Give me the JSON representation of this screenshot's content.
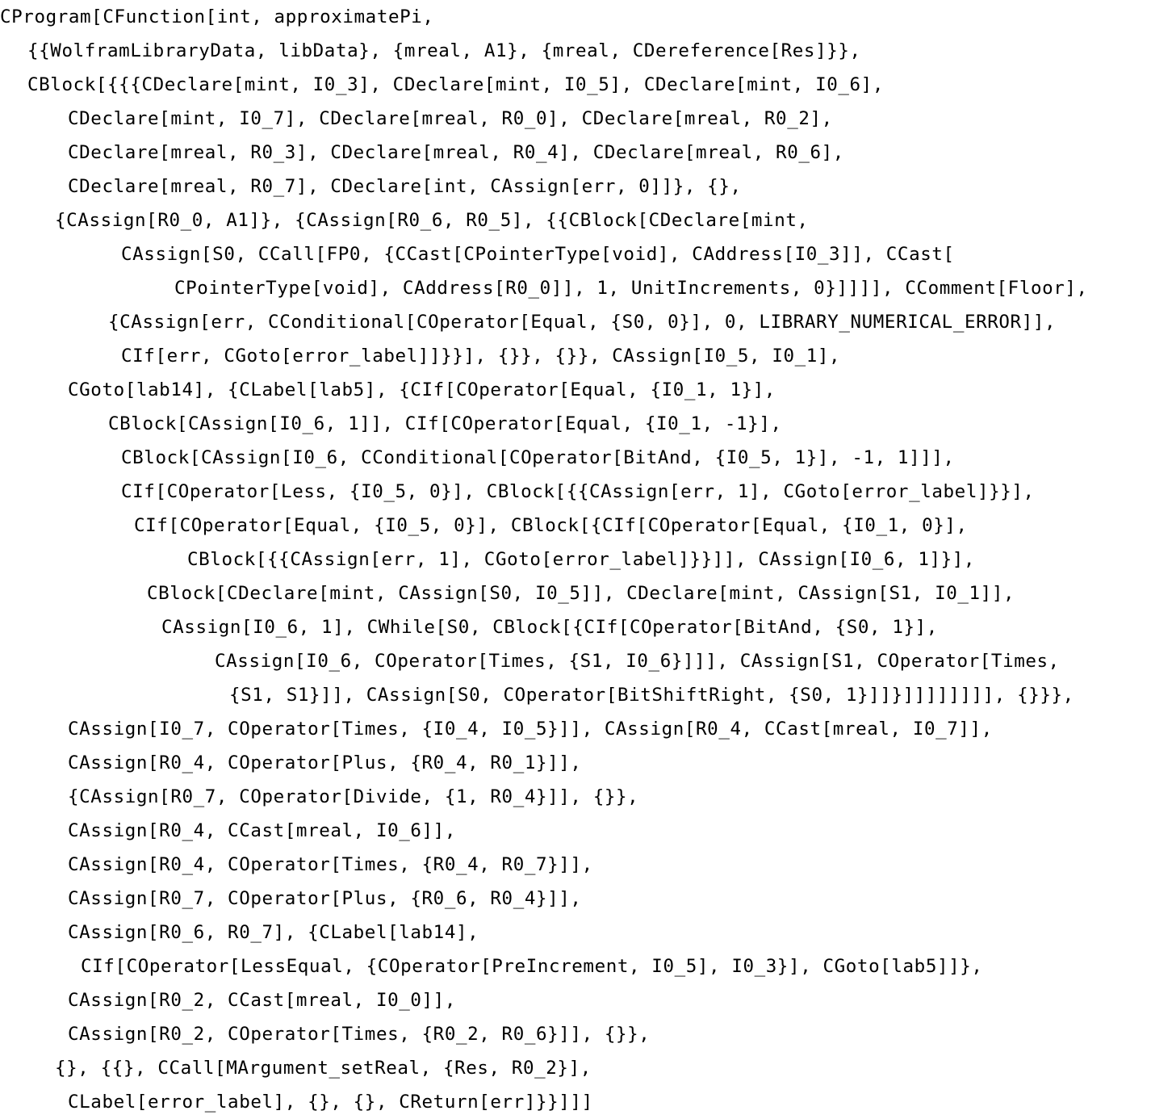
{
  "code": {
    "lines": [
      "CProgram[CFunction[int, approximatePi,",
      "  {{WolframLibraryData, libData}, {mreal, A1}, {mreal, CDereference[Res]}},",
      "  CBlock[{{{CDeclare[mint, I0_3], CDeclare[mint, I0_5], CDeclare[mint, I0_6],",
      "     CDeclare[mint, I0_7], CDeclare[mreal, R0_0], CDeclare[mreal, R0_2],",
      "     CDeclare[mreal, R0_3], CDeclare[mreal, R0_4], CDeclare[mreal, R0_6],",
      "     CDeclare[mreal, R0_7], CDeclare[int, CAssign[err, 0]]}, {},",
      "    {CAssign[R0_0, A1]}, {CAssign[R0_6, R0_5], {{CBlock[CDeclare[mint,",
      "         CAssign[S0, CCall[FP0, {CCast[CPointerType[void], CAddress[I0_3]], CCast[",
      "             CPointerType[void], CAddress[R0_0]], 1, UnitIncrements, 0}]]]], CComment[Floor],",
      "        {CAssign[err, CConditional[COperator[Equal, {S0, 0}], 0, LIBRARY_NUMERICAL_ERROR]],",
      "         CIf[err, CGoto[error_label]]}}], {}}, {}}, CAssign[I0_5, I0_1],",
      "     CGoto[lab14], {CLabel[lab5], {CIf[COperator[Equal, {I0_1, 1}],",
      "        CBlock[CAssign[I0_6, 1]], CIf[COperator[Equal, {I0_1, -1}],",
      "         CBlock[CAssign[I0_6, CConditional[COperator[BitAnd, {I0_5, 1}], -1, 1]]],",
      "         CIf[COperator[Less, {I0_5, 0}], CBlock[{{CAssign[err, 1], CGoto[error_label]}}],",
      "          CIf[COperator[Equal, {I0_5, 0}], CBlock[{CIf[COperator[Equal, {I0_1, 0}],",
      "              CBlock[{{CAssign[err, 1], CGoto[error_label]}}]], CAssign[I0_6, 1]}],",
      "           CBlock[CDeclare[mint, CAssign[S0, I0_5]], CDeclare[mint, CAssign[S1, I0_1]],",
      "            CAssign[I0_6, 1], CWhile[S0, CBlock[{CIf[COperator[BitAnd, {S0, 1}],",
      "                CAssign[I0_6, COperator[Times, {S1, I0_6}]]], CAssign[S1, COperator[Times,",
      "                 {S1, S1}]], CAssign[S0, COperator[BitShiftRight, {S0, 1}]]}]]]]]]]], {}}},",
      "     CAssign[I0_7, COperator[Times, {I0_4, I0_5}]], CAssign[R0_4, CCast[mreal, I0_7]],",
      "     CAssign[R0_4, COperator[Plus, {R0_4, R0_1}]],",
      "     {CAssign[R0_7, COperator[Divide, {1, R0_4}]], {}},",
      "     CAssign[R0_4, CCast[mreal, I0_6]],",
      "     CAssign[R0_4, COperator[Times, {R0_4, R0_7}]],",
      "     CAssign[R0_7, COperator[Plus, {R0_6, R0_4}]],",
      "     CAssign[R0_6, R0_7], {CLabel[lab14],",
      "      CIf[COperator[LessEqual, {COperator[PreIncrement, I0_5], I0_3}], CGoto[lab5]]},",
      "     CAssign[R0_2, CCast[mreal, I0_0]],",
      "     CAssign[R0_2, COperator[Times, {R0_2, R0_6}]], {}},",
      "    {}, {{}, CCall[MArgument_setReal, {Res, R0_2}],",
      "     CLabel[error_label], {}, {}, CReturn[err]}}]]]"
    ]
  }
}
